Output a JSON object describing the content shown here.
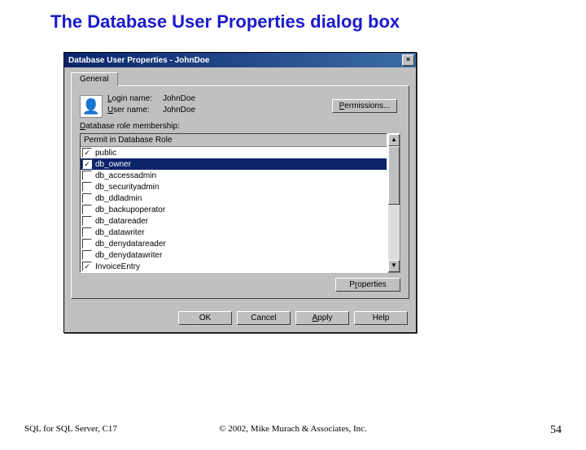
{
  "slide_title": "The Database User Properties dialog box",
  "dialog": {
    "title": "Database User Properties - JohnDoe",
    "tab": "General",
    "login_label": "Login name:",
    "login_value": "JohnDoe",
    "user_label": "User name:",
    "user_value": "JohnDoe",
    "permissions_btn": "Permissions...",
    "membership_label": "Database role membership:",
    "list_header": "Permit in Database Role",
    "roles": [
      {
        "checked": true,
        "name": "public"
      },
      {
        "checked": true,
        "name": "db_owner"
      },
      {
        "checked": false,
        "name": "db_accessadmin"
      },
      {
        "checked": false,
        "name": "db_securityadmin"
      },
      {
        "checked": false,
        "name": "db_ddladmin"
      },
      {
        "checked": false,
        "name": "db_backupoperator"
      },
      {
        "checked": false,
        "name": "db_datareader"
      },
      {
        "checked": false,
        "name": "db_datawriter"
      },
      {
        "checked": false,
        "name": "db_denydatareader"
      },
      {
        "checked": false,
        "name": "db_denydatawriter"
      },
      {
        "checked": true,
        "name": "InvoiceEntry"
      }
    ],
    "selected_index": 1,
    "properties_btn": "Properties",
    "ok_btn": "OK",
    "cancel_btn": "Cancel",
    "apply_btn": "Apply",
    "help_btn": "Help"
  },
  "footer": {
    "left": "SQL for SQL Server, C17",
    "center": "© 2002, Mike Murach & Associates, Inc.",
    "right": "54"
  }
}
